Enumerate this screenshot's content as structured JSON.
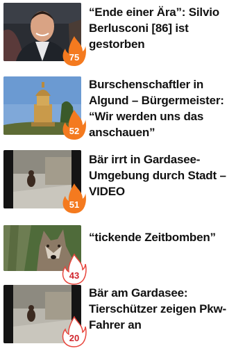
{
  "articles": [
    {
      "title": "“Ende einer Ära”: Silvio Berlusconi [86] ist gestorben",
      "score": "75",
      "thumb_icon": "portrait-photo"
    },
    {
      "title": "Burschenschaftler in Algund – Bürgermeister: “Wir werden uns das anschauen”",
      "score": "52",
      "thumb_icon": "monument-photo"
    },
    {
      "title": "Bär irrt in Gardasee-Umgebung durch Stadt – VIDEO",
      "score": "51",
      "thumb_icon": "street-video-still"
    },
    {
      "title": "“tickende Zeitbomben”",
      "score": "43",
      "thumb_icon": "wolf-photo"
    },
    {
      "title": "Bär am Gardasee: Tierschützer zeigen Pkw-Fahrer an",
      "score": "20",
      "thumb_icon": "street-video-still"
    }
  ],
  "colors": {
    "flame_hot": "#f47a1f",
    "flame_cool_stroke": "#e8453c",
    "text": "#111111"
  }
}
